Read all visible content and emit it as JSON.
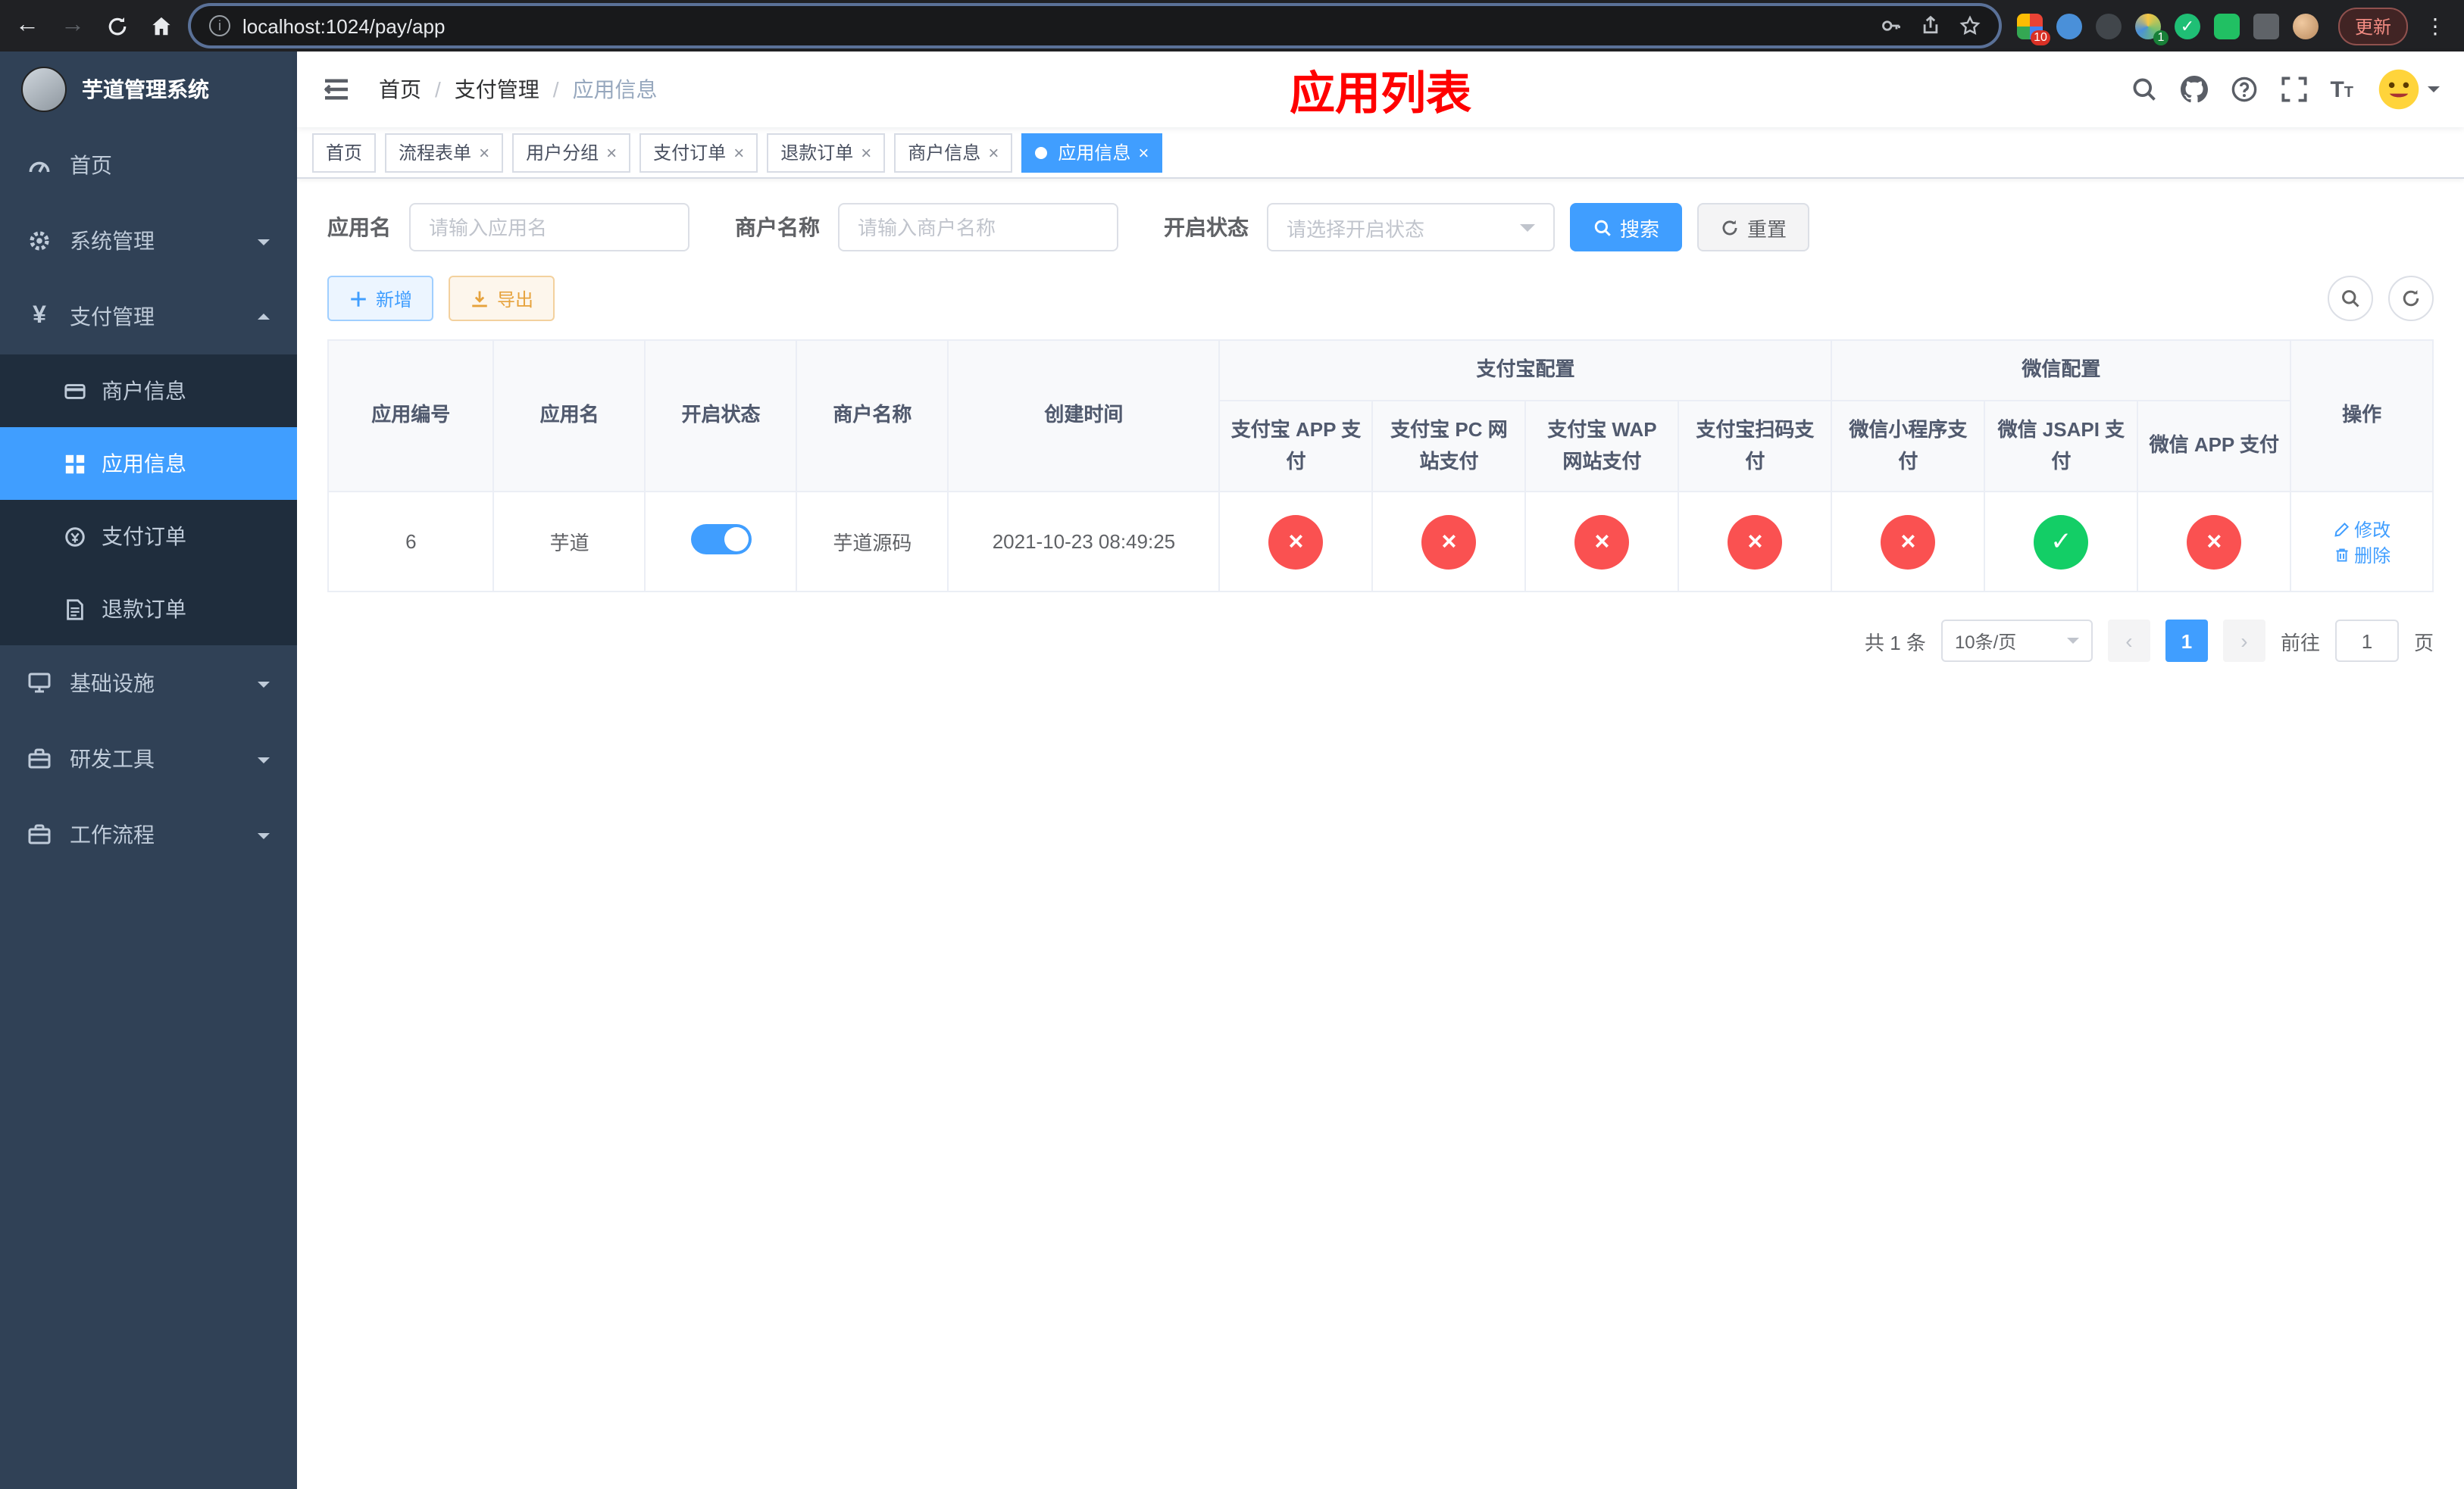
{
  "colors": {
    "primary": "#409eff",
    "danger": "#fa5151",
    "success": "#13ce66",
    "warning": "#e6a23c",
    "sidebar_bg": "#304156",
    "title_red": "#ff0000"
  },
  "browser": {
    "url": "localhost:1024/pay/app",
    "update_label": "更新",
    "ext_badge_grid": "10",
    "ext_badge_circle": "1"
  },
  "sidebar": {
    "app_title": "芋道管理系统",
    "menu": [
      {
        "label": "首页"
      },
      {
        "label": "系统管理"
      },
      {
        "label": "支付管理"
      },
      {
        "label": "基础设施"
      },
      {
        "label": "研发工具"
      },
      {
        "label": "工作流程"
      }
    ],
    "submenu": [
      {
        "label": "商户信息"
      },
      {
        "label": "应用信息"
      },
      {
        "label": "支付订单"
      },
      {
        "label": "退款订单"
      }
    ]
  },
  "navbar": {
    "breadcrumb": [
      "首页",
      "支付管理",
      "应用信息"
    ],
    "page_title": "应用列表"
  },
  "tabs": [
    {
      "label": "首页"
    },
    {
      "label": "流程表单"
    },
    {
      "label": "用户分组"
    },
    {
      "label": "支付订单"
    },
    {
      "label": "退款订单"
    },
    {
      "label": "商户信息"
    },
    {
      "label": "应用信息"
    }
  ],
  "filter": {
    "app_name_label": "应用名",
    "app_name_placeholder": "请输入应用名",
    "merchant_label": "商户名称",
    "merchant_placeholder": "请输入商户名称",
    "status_label": "开启状态",
    "status_placeholder": "请选择开启状态",
    "search_label": "搜索",
    "reset_label": "重置"
  },
  "toolbar": {
    "add_label": "新增",
    "export_label": "导出"
  },
  "table": {
    "columns": {
      "app_id": "应用编号",
      "app_name": "应用名",
      "status": "开启状态",
      "merchant": "商户名称",
      "created": "创建时间",
      "alipay_group": "支付宝配置",
      "wechat_group": "微信配置",
      "alipay_app": "支付宝 APP 支付",
      "alipay_pc": "支付宝 PC 网站支付",
      "alipay_wap": "支付宝 WAP 网站支付",
      "alipay_qr": "支付宝扫码支付",
      "wechat_mini": "微信小程序支付",
      "wechat_jsapi": "微信 JSAPI 支付",
      "wechat_app": "微信 APP 支付",
      "actions": "操作"
    },
    "row": {
      "app_id": "6",
      "app_name": "芋道",
      "status_on": true,
      "merchant": "芋道源码",
      "created": "2021-10-23 08:49:25",
      "configs": [
        "no",
        "no",
        "no",
        "no",
        "no",
        "yes",
        "no"
      ],
      "edit_label": "修改",
      "delete_label": "删除"
    }
  },
  "pagination": {
    "total": "共 1 条",
    "page_size": "10条/页",
    "page": "1",
    "goto_label": "前往",
    "goto_value": "1",
    "goto_unit": "页"
  }
}
